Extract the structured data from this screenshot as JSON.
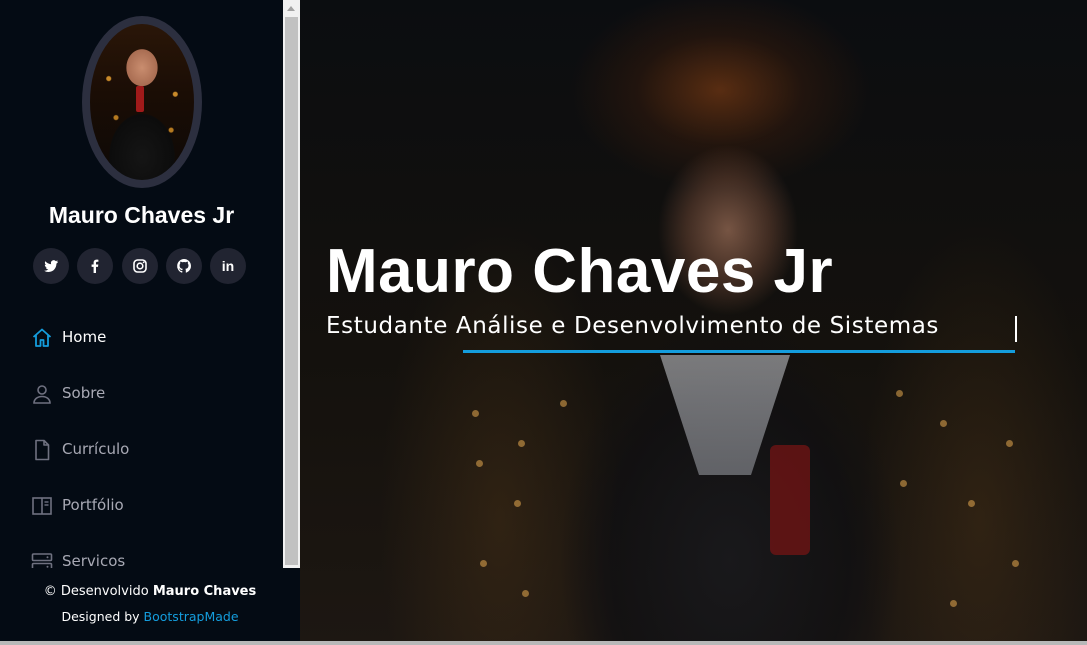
{
  "sidebar": {
    "profile_name": "Mauro Chaves Jr",
    "social": [
      {
        "icon": "twitter-icon"
      },
      {
        "icon": "facebook-icon"
      },
      {
        "icon": "instagram-icon"
      },
      {
        "icon": "github-icon"
      },
      {
        "icon": "linkedin-icon",
        "label": "in"
      }
    ],
    "nav": [
      {
        "label": "Home",
        "icon": "home-icon",
        "active": true
      },
      {
        "label": "Sobre",
        "icon": "person-icon"
      },
      {
        "label": "Currículo",
        "icon": "file-icon"
      },
      {
        "label": "Portfólio",
        "icon": "book-half-icon"
      },
      {
        "label": "Servicos",
        "icon": "server-icon"
      }
    ],
    "footer": {
      "copyright_prefix": "© Desenvolvido ",
      "copyright_name": "Mauro Chaves",
      "designed_prefix": "Designed by ",
      "designed_link": "BootstrapMade"
    }
  },
  "hero": {
    "title": "Mauro Chaves Jr",
    "subtitle": "Estudante Análise e Desenvolvimento de Sistemas"
  },
  "colors": {
    "accent": "#149ddd",
    "sidebar_bg": "#040b14",
    "social_bg": "#212431",
    "nav_text": "#a8a9b4"
  }
}
